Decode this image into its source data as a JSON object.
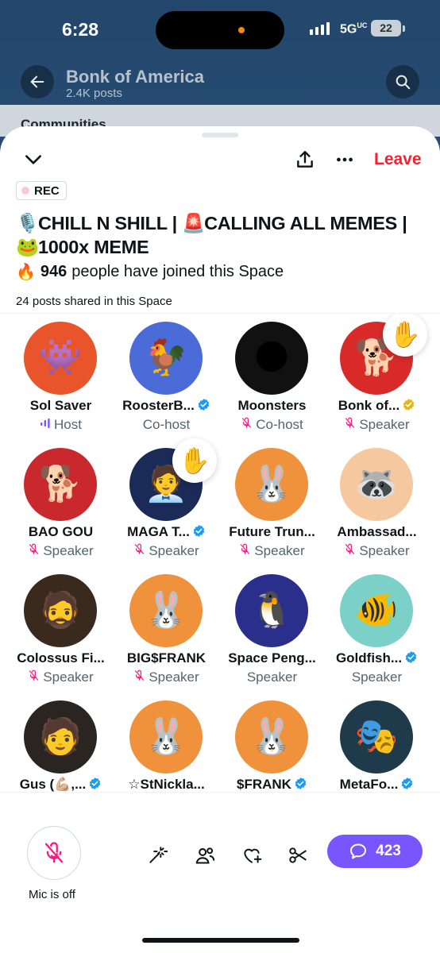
{
  "status_bar": {
    "time": "6:28",
    "network": "5G",
    "network_suffix": "UC",
    "battery": "22"
  },
  "background_page": {
    "title": "Bonk of America",
    "subtitle": "2.4K posts",
    "section": "Communities"
  },
  "sheet": {
    "leave_label": "Leave",
    "rec_label": "REC",
    "title_parts": {
      "emoji1": "🎙️",
      "part1": "CHILL N SHILL | ",
      "emoji2": "🚨",
      "part2": "CALLING ALL MEMES |",
      "emoji3": "🐸",
      "part3": "1000x MEME"
    },
    "joined": {
      "icon": "🔥",
      "count": "946",
      "text": "people have joined this Space"
    },
    "posts_shared": "24 posts shared in this Space"
  },
  "members": [
    {
      "name": "Sol Saver",
      "role": "Host",
      "role_icon": "host-bars-icon",
      "verified": false,
      "hand": false,
      "face": "👾",
      "bg": "#e8552a"
    },
    {
      "name": "RoosterB...",
      "role": "Co-host",
      "role_icon": "none",
      "verified": true,
      "verified_color": "#1d9bf0",
      "hand": false,
      "face": "🐓",
      "bg": "#4a6bd8"
    },
    {
      "name": "Moonsters",
      "role": "Co-host",
      "role_icon": "mic-off-icon",
      "verified": false,
      "hand": false,
      "face": "🌑",
      "bg": "#111111"
    },
    {
      "name": "Bonk of...",
      "role": "Speaker",
      "role_icon": "mic-off-icon",
      "verified": true,
      "verified_color": "#e2b719",
      "hand": true,
      "face": "🐕",
      "bg": "#d92a2a"
    },
    {
      "name": "BAO GOU",
      "role": "Speaker",
      "role_icon": "mic-off-icon",
      "verified": false,
      "hand": false,
      "face": "🐕",
      "bg": "#c9282c"
    },
    {
      "name": "MAGA T...",
      "role": "Speaker",
      "role_icon": "mic-off-icon",
      "verified": true,
      "verified_color": "#1d9bf0",
      "hand": true,
      "face": "🧑‍💼",
      "bg": "#1a2b57"
    },
    {
      "name": "Future Trun...",
      "role": "Speaker",
      "role_icon": "mic-off-icon",
      "verified": false,
      "hand": false,
      "face": "🐰",
      "bg": "#f0923c"
    },
    {
      "name": "Ambassad...",
      "role": "Speaker",
      "role_icon": "mic-off-icon",
      "verified": false,
      "hand": false,
      "face": "🦝",
      "bg": "#f5c8a0"
    },
    {
      "name": "Colossus Fi...",
      "role": "Speaker",
      "role_icon": "mic-off-icon",
      "verified": false,
      "hand": false,
      "face": "🧔",
      "bg": "#3a2a1e"
    },
    {
      "name": "BIG$FRANK",
      "role": "Speaker",
      "role_icon": "mic-off-icon",
      "verified": false,
      "hand": false,
      "face": "🐰",
      "bg": "#f0923c"
    },
    {
      "name": "Space Peng...",
      "role": "Speaker",
      "role_icon": "none",
      "verified": false,
      "hand": false,
      "face": "🐧",
      "bg": "#2a2f8c"
    },
    {
      "name": "Goldfish...",
      "role": "Speaker",
      "role_icon": "none",
      "verified": true,
      "verified_color": "#1d9bf0",
      "hand": false,
      "face": "🐠",
      "bg": "#7bd0c8"
    },
    {
      "name": "Gus (💪🏼,...",
      "role": "",
      "role_icon": "none",
      "verified": true,
      "verified_color": "#1d9bf0",
      "hand": false,
      "face": "🧑",
      "bg": "#2b2522"
    },
    {
      "name": "☆StNickla...",
      "role": "",
      "role_icon": "none",
      "verified": false,
      "hand": false,
      "face": "🐰",
      "bg": "#f0923c"
    },
    {
      "name": "$FRANK",
      "role": "",
      "role_icon": "none",
      "verified": true,
      "verified_color": "#1d9bf0",
      "hand": false,
      "face": "🐰",
      "bg": "#f0923c"
    },
    {
      "name": "MetaFo...",
      "role": "",
      "role_icon": "none",
      "verified": true,
      "verified_color": "#1d9bf0",
      "hand": false,
      "face": "🎭",
      "bg": "#1f3a4a"
    }
  ],
  "bottom_bar": {
    "mic_label": "Mic is off",
    "chat_count": "423",
    "tools": [
      "magic-wand-icon",
      "people-icon",
      "heart-plus-icon",
      "scissors-icon"
    ]
  },
  "colors": {
    "accent": "#7856ff",
    "leave": "#f4212e",
    "verified": "#1d9bf0",
    "gold_verified": "#e2b719",
    "mic_off": "#f91880"
  }
}
